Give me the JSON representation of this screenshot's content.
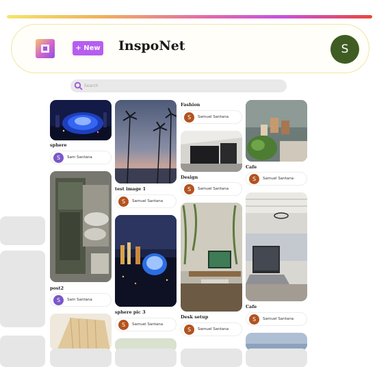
{
  "header": {
    "new_label": "+ New",
    "app_title": "InspoNet",
    "user_initial": "S",
    "accent": "#b65ef0",
    "avatar_color": "#3f5c22"
  },
  "search": {
    "placeholder": "Search"
  },
  "pins": [
    {
      "title": "sphere",
      "author": "Sam Santana",
      "initial": "S",
      "avatar_color": "#7a57c9"
    },
    {
      "title": "post2",
      "author": "Sam Santana",
      "initial": "S",
      "avatar_color": "#7a57c9"
    },
    {
      "title": "test image 1",
      "author": "Samuel Santana",
      "initial": "S",
      "avatar_color": "#b3531f"
    },
    {
      "title": "sphere pic 3",
      "author": "Samuel Santana",
      "initial": "S",
      "avatar_color": "#b3531f"
    },
    {
      "title": "Fashion",
      "author": "Samuel Santana",
      "initial": "S",
      "avatar_color": "#b3531f"
    },
    {
      "title": "Design",
      "author": "Samuel Santana",
      "initial": "S",
      "avatar_color": "#b3531f"
    },
    {
      "title": "Desk setup",
      "author": "Samuel Santana",
      "initial": "S",
      "avatar_color": "#b3531f"
    },
    {
      "title": "Cafe",
      "author": "Samuel Santana",
      "initial": "S",
      "avatar_color": "#b3531f"
    },
    {
      "title": "Cafe",
      "author": "Samuel Santana",
      "initial": "S",
      "avatar_color": "#b3531f"
    }
  ]
}
